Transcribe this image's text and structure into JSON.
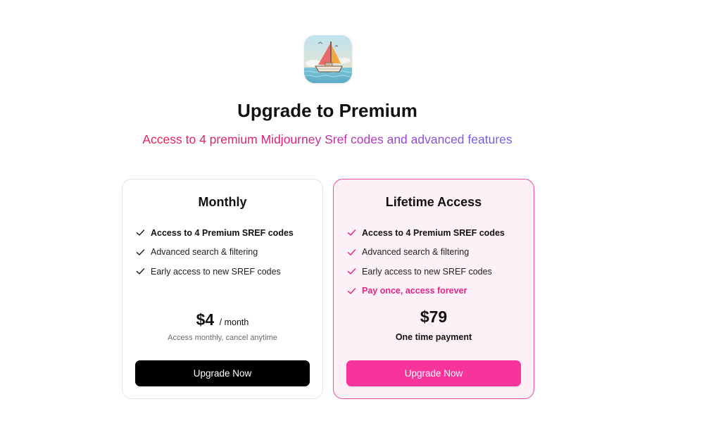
{
  "header": {
    "logo_icon": "sailboat-app-icon",
    "title": "Upgrade to Premium",
    "subtitle": "Access to 4 premium Midjourney Sref codes and advanced features"
  },
  "colors": {
    "accent_pink": "#f7349b",
    "lifetime_border": "#ec4f9f",
    "lifetime_bg": "#fdf0f6"
  },
  "plans": [
    {
      "name": "Monthly",
      "features": [
        "Access to 4 Premium SREF codes",
        "Advanced search & filtering",
        "Early access to new SREF codes"
      ],
      "price": "$4",
      "period": "/ month",
      "note": "Access monthly, cancel anytime",
      "button_label": "Upgrade Now"
    },
    {
      "name": "Lifetime Access",
      "features": [
        "Access to 4 Premium SREF codes",
        "Advanced search & filtering",
        "Early access to new SREF codes",
        "Pay once, access forever"
      ],
      "price": "$79",
      "note": "One time payment",
      "button_label": "Upgrade Now"
    }
  ]
}
